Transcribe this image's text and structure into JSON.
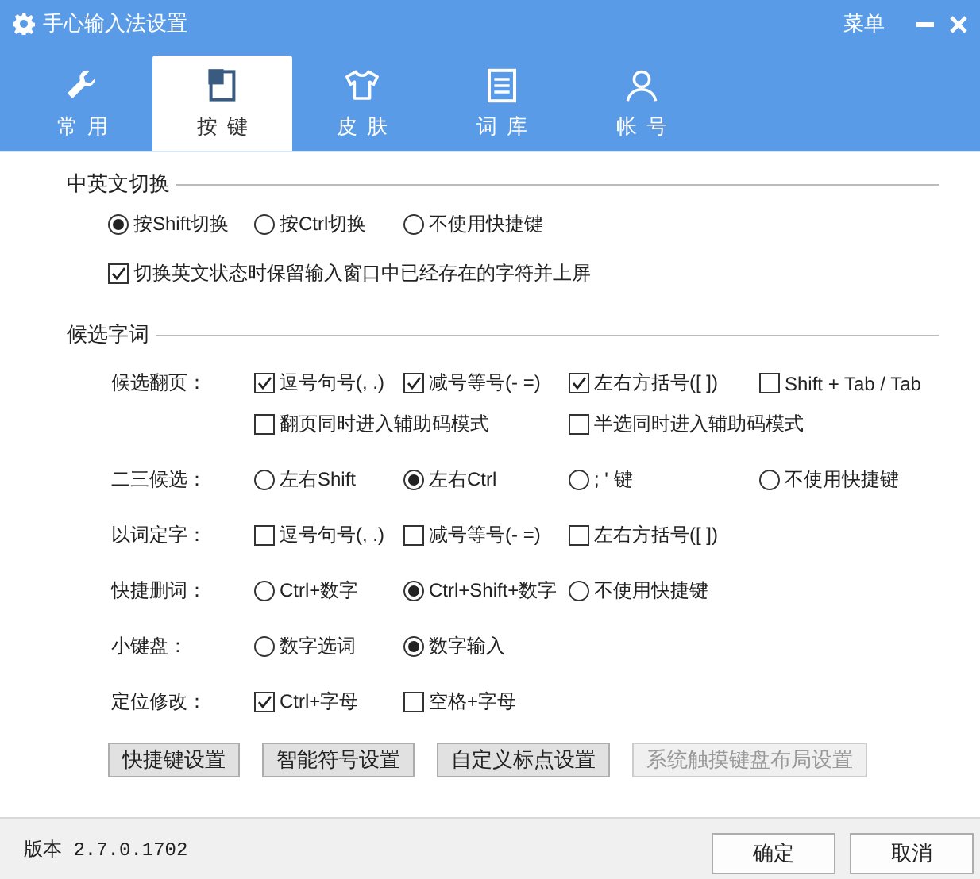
{
  "window": {
    "title": "手心输入法设置",
    "menu": "菜单"
  },
  "tabs": [
    {
      "label": "常用",
      "selected": false
    },
    {
      "label": "按键",
      "selected": true
    },
    {
      "label": "皮肤",
      "selected": false
    },
    {
      "label": "词库",
      "selected": false
    },
    {
      "label": "帐号",
      "selected": false
    }
  ],
  "sections": [
    {
      "title": "中英文切换",
      "rows": [
        {
          "kind": "plain",
          "options": [
            {
              "kind": "radio",
              "label": "按Shift切换",
              "checked": true
            },
            {
              "kind": "radio",
              "label": "按Ctrl切换",
              "checked": false
            },
            {
              "kind": "radio",
              "label": "不使用快捷键",
              "checked": false
            }
          ]
        },
        {
          "kind": "wide",
          "options": [
            {
              "kind": "checkbox",
              "label": "切换英文状态时保留输入窗口中已经存在的字符并上屏",
              "checked": true
            }
          ]
        }
      ]
    },
    {
      "title": "候选字词",
      "rows": [
        {
          "kind": "labeled",
          "label": "候选翻页：",
          "options": [
            {
              "kind": "checkbox",
              "label": "逗号句号(, .)",
              "checked": true
            },
            {
              "kind": "checkbox",
              "label": "减号等号(- =)",
              "checked": true
            },
            {
              "kind": "checkbox",
              "label": "左右方括号([ ])",
              "checked": true
            },
            {
              "kind": "checkbox",
              "label": "Shift + Tab / Tab",
              "checked": false
            }
          ]
        },
        {
          "kind": "continuation",
          "options": [
            {
              "kind": "checkbox",
              "label": "翻页同时进入辅助码模式",
              "checked": false
            },
            {
              "kind": "checkbox",
              "label": "半选同时进入辅助码模式",
              "checked": false
            }
          ]
        },
        {
          "kind": "labeled",
          "label": "二三候选：",
          "options": [
            {
              "kind": "radio",
              "label": "左右Shift",
              "checked": false
            },
            {
              "kind": "radio",
              "label": "左右Ctrl",
              "checked": true
            },
            {
              "kind": "radio",
              "label": "; ' 键",
              "checked": false
            },
            {
              "kind": "radio",
              "label": "不使用快捷键",
              "checked": false
            }
          ]
        },
        {
          "kind": "labeled",
          "label": "以词定字：",
          "options": [
            {
              "kind": "checkbox",
              "label": "逗号句号(, .)",
              "checked": false
            },
            {
              "kind": "checkbox",
              "label": "减号等号(- =)",
              "checked": false
            },
            {
              "kind": "checkbox",
              "label": "左右方括号([ ])",
              "checked": false
            }
          ]
        },
        {
          "kind": "labeled",
          "label": "快捷删词：",
          "options": [
            {
              "kind": "radio",
              "label": "Ctrl+数字",
              "checked": false
            },
            {
              "kind": "radio",
              "label": "Ctrl+Shift+数字",
              "checked": true
            },
            {
              "kind": "radio",
              "label": "不使用快捷键",
              "checked": false
            }
          ]
        },
        {
          "kind": "labeled",
          "label": "小键盘：",
          "options": [
            {
              "kind": "radio",
              "label": "数字选词",
              "checked": false
            },
            {
              "kind": "radio",
              "label": "数字输入",
              "checked": true
            }
          ]
        },
        {
          "kind": "labeled",
          "label": "定位修改：",
          "options": [
            {
              "kind": "checkbox",
              "label": "Ctrl+字母",
              "checked": true
            },
            {
              "kind": "checkbox",
              "label": "空格+字母",
              "checked": false
            }
          ]
        }
      ]
    }
  ],
  "buttons": [
    {
      "label": "快捷键设置",
      "disabled": false
    },
    {
      "label": "智能符号设置",
      "disabled": false
    },
    {
      "label": "自定义标点设置",
      "disabled": false
    },
    {
      "label": "系统触摸键盘布局设置",
      "disabled": true
    }
  ],
  "footer": {
    "version": "版本 2.7.0.1702",
    "buttons": [
      "确定",
      "取消"
    ]
  }
}
